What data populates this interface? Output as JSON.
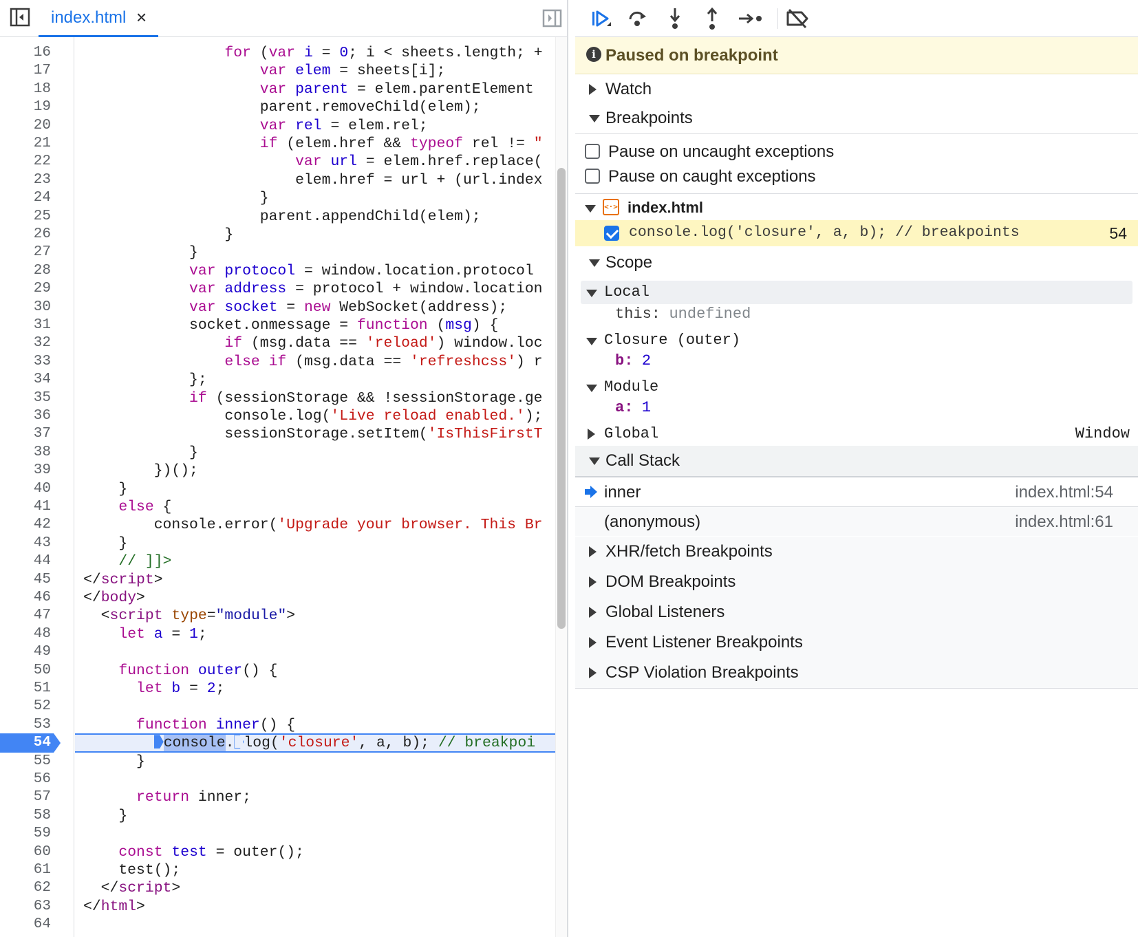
{
  "editor": {
    "tab_title": "index.html",
    "tab_close": "×",
    "current_line": "54",
    "lines": [
      {
        "n": "16",
        "html": "                <span class='kw'>for</span> (<span class='kw'>var</span> <span class='def'>i</span> = <span class='num'>0</span>; i &lt; sheets.length; +"
      },
      {
        "n": "17",
        "html": "                    <span class='kw'>var</span> <span class='def'>elem</span> = sheets[i];"
      },
      {
        "n": "18",
        "html": "                    <span class='kw'>var</span> <span class='def'>parent</span> = elem.parentElement"
      },
      {
        "n": "19",
        "html": "                    parent.removeChild(elem);"
      },
      {
        "n": "20",
        "html": "                    <span class='kw'>var</span> <span class='def'>rel</span> = elem.rel;"
      },
      {
        "n": "21",
        "html": "                    <span class='kw'>if</span> (elem.href &amp;&amp; <span class='kw'>typeof</span> rel != <span class='str'>\"</span>"
      },
      {
        "n": "22",
        "html": "                        <span class='kw'>var</span> <span class='def'>url</span> = elem.href.replace("
      },
      {
        "n": "23",
        "html": "                        elem.href = url + (url.index"
      },
      {
        "n": "24",
        "html": "                    }"
      },
      {
        "n": "25",
        "html": "                    parent.appendChild(elem);"
      },
      {
        "n": "26",
        "html": "                }"
      },
      {
        "n": "27",
        "html": "            }"
      },
      {
        "n": "28",
        "html": "            <span class='kw'>var</span> <span class='def'>protocol</span> = window.location.protocol"
      },
      {
        "n": "29",
        "html": "            <span class='kw'>var</span> <span class='def'>address</span> = protocol + window.location"
      },
      {
        "n": "30",
        "html": "            <span class='kw'>var</span> <span class='def'>socket</span> = <span class='kw'>new</span> WebSocket(address);"
      },
      {
        "n": "31",
        "html": "            socket.onmessage = <span class='kw'>function</span> (<span class='def'>msg</span>) {"
      },
      {
        "n": "32",
        "html": "                <span class='kw'>if</span> (msg.data == <span class='str'>'reload'</span>) window.loc"
      },
      {
        "n": "33",
        "html": "                <span class='kw'>else</span> <span class='kw'>if</span> (msg.data == <span class='str'>'refreshcss'</span>) r"
      },
      {
        "n": "34",
        "html": "            };"
      },
      {
        "n": "35",
        "html": "            <span class='kw'>if</span> (sessionStorage &amp;&amp; !sessionStorage.ge"
      },
      {
        "n": "36",
        "html": "                console.log(<span class='str'>'Live reload enabled.'</span>);"
      },
      {
        "n": "37",
        "html": "                sessionStorage.setItem(<span class='str'>'IsThisFirstT</span>"
      },
      {
        "n": "38",
        "html": "            }"
      },
      {
        "n": "39",
        "html": "        })();"
      },
      {
        "n": "40",
        "html": "    }"
      },
      {
        "n": "41",
        "html": "    <span class='kw'>else</span> {"
      },
      {
        "n": "42",
        "html": "        console.error(<span class='str'>'Upgrade your browser. This Br</span>"
      },
      {
        "n": "43",
        "html": "    }"
      },
      {
        "n": "44",
        "html": "    <span class='cm'>// ]]&gt;</span>"
      },
      {
        "n": "45",
        "html": "&lt;/<span class='tag'>script</span>&gt;"
      },
      {
        "n": "46",
        "html": "&lt;/<span class='tag'>body</span>&gt;"
      },
      {
        "n": "47",
        "html": "  &lt;<span class='tag'>script</span> <span class='attr'>type</span>=<span class='av'>\"module\"</span>&gt;"
      },
      {
        "n": "48",
        "html": "    <span class='kw'>let</span> <span class='def'>a</span> = <span class='num'>1</span>;"
      },
      {
        "n": "49",
        "html": ""
      },
      {
        "n": "50",
        "html": "    <span class='kw'>function</span> <span class='def'>outer</span>() {"
      },
      {
        "n": "51",
        "html": "      <span class='kw'>let</span> <span class='def'>b</span> = <span class='num'>2</span>;"
      },
      {
        "n": "52",
        "html": ""
      },
      {
        "n": "53",
        "html": "      <span class='kw'>function</span> <span class='def'>inner</span>() {"
      },
      {
        "n": "54",
        "html": "        <span style='display:inline-block;width:14px;height:20px;background:#4285f4;clip-path:polygon(0 0,60% 0,100% 50%,60% 100%,0 100%);vertical-align:-3px'></span><span style='background:#a7c0f4'>console</span>.<span style='display:inline-block;width:14px;height:20px;border:1.5px solid #4285f4;clip-path:polygon(0 0,60% 0,100% 50%,60% 100%,0 100%);vertical-align:-3px'></span>log(<span class='str'>'closure'</span>, a, b); <span class='cm'>// breakpoi</span>"
      },
      {
        "n": "55",
        "html": "      }"
      },
      {
        "n": "56",
        "html": ""
      },
      {
        "n": "57",
        "html": "      <span class='kw'>return</span> inner;"
      },
      {
        "n": "58",
        "html": "    }"
      },
      {
        "n": "59",
        "html": ""
      },
      {
        "n": "60",
        "html": "    <span class='kw'>const</span> <span class='def'>test</span> = outer();"
      },
      {
        "n": "61",
        "html": "    test();"
      },
      {
        "n": "62",
        "html": "  &lt;/<span class='tag'>script</span>&gt;"
      },
      {
        "n": "63",
        "html": "&lt;/<span class='tag'>html</span>&gt;"
      },
      {
        "n": "64",
        "html": ""
      }
    ]
  },
  "debugger": {
    "paused_message": "Paused on breakpoint",
    "info_glyph": "i",
    "sections": {
      "watch": "Watch",
      "breakpoints": "Breakpoints",
      "scope": "Scope",
      "call_stack": "Call Stack",
      "xhr": "XHR/fetch Breakpoints",
      "dom": "DOM Breakpoints",
      "global_listeners": "Global Listeners",
      "event_listener": "Event Listener Breakpoints",
      "csp": "CSP Violation Breakpoints"
    },
    "pause_uncaught": "Pause on uncaught exceptions",
    "pause_caught": "Pause on caught exceptions",
    "bp_file": "index.html",
    "bp_file_icon_glyph": "<·>",
    "bp_code": "console.log('closure', a, b); // breakpoints",
    "bp_line": "54",
    "scope": {
      "local": "Local",
      "this_name": "this:",
      "this_value": "undefined",
      "closure": "Closure (outer)",
      "b_name": "b:",
      "b_value": "2",
      "module": "Module",
      "a_name": "a:",
      "a_value": "1",
      "global": "Global",
      "global_value": "Window"
    },
    "call_stack": [
      {
        "name": "inner",
        "location": "index.html:54"
      },
      {
        "name": "(anonymous)",
        "location": "index.html:61"
      }
    ]
  },
  "colors": {
    "accent": "#1a73e8",
    "breakpoint": "#4285f4",
    "paused_banner": "#fefae0",
    "bp_row_highlight": "#fef6c1"
  }
}
